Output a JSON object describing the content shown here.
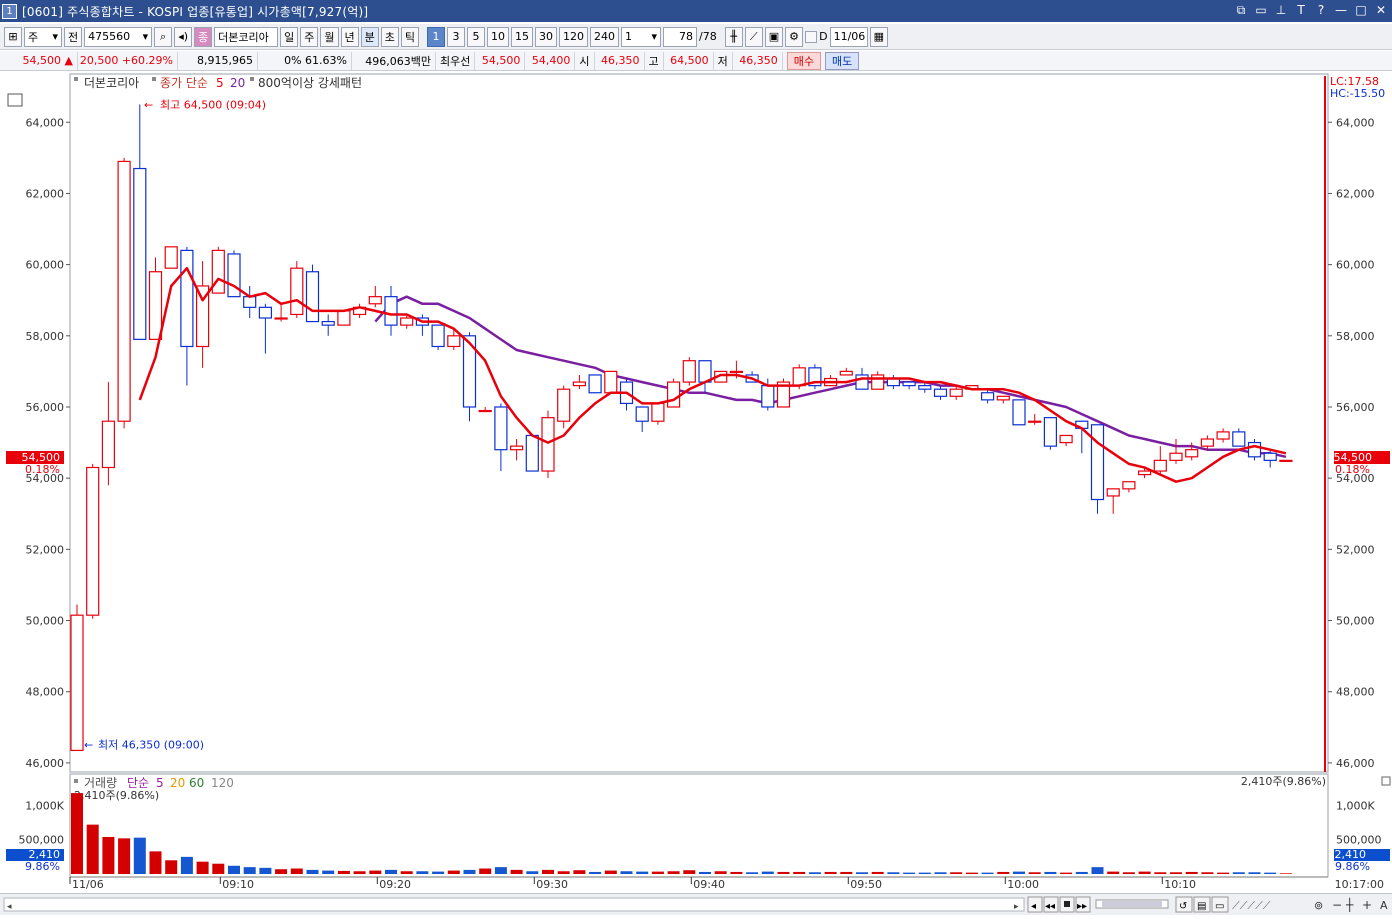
{
  "window": {
    "title": "[0601] 주식종합차트 - KOSPI 업종[유통업] 시가총액[7,927(억)]",
    "win_number": "1"
  },
  "toolbar": {
    "market_type": "주",
    "prev_label": "전",
    "code": "475560",
    "type_badge": "종",
    "stock_name": "더본코리아",
    "periods": [
      "일",
      "주",
      "월",
      "년",
      "분",
      "초",
      "틱"
    ],
    "intervals": [
      "1",
      "3",
      "5",
      "10",
      "15",
      "30",
      "120",
      "240"
    ],
    "count_value": "1",
    "page_current": "78",
    "page_total": "/78",
    "d_label": "D",
    "date": "11/06"
  },
  "pricebar": {
    "price": "54,500",
    "change": "20,500",
    "change_pct": "+60.29%",
    "volume": "8,915,965",
    "ratio1": "0%",
    "ratio2": "61.63%",
    "amount": "496,063백만",
    "priority_label": "최우선",
    "ask": "54,500",
    "bid": "54,400",
    "open_label": "시",
    "open": "46,350",
    "high_label": "고",
    "high": "64,500",
    "low_label": "저",
    "low": "46,350",
    "buy_label": "매수",
    "sell_label": "매도"
  },
  "chart_legend": {
    "name": "더본코리아",
    "ma_label": "종가 단순",
    "ma5": "5",
    "ma20": "20",
    "pattern": "800억이상 강세패턴",
    "lc": "LC:17.58",
    "hc": "HC:-15.50"
  },
  "annotations": {
    "high": "최고 64,500 (09:04)",
    "low": "최저 46,350 (09:00)",
    "last_price": "54,500",
    "last_pct": "0.18%"
  },
  "volume_legend": {
    "label": "거래량",
    "ma_label": "단순",
    "ma5": "5",
    "ma20": "20",
    "ma60": "60",
    "ma120": "120",
    "current": "2,410주(9.86%)",
    "last": "2,410",
    "last_pct": "9.86%"
  },
  "colors": {
    "up": "#e8000b",
    "down": "#0b2fd3",
    "ma5": "#e8000b",
    "ma20": "#7b1fa2",
    "accent_bar": "#d40000"
  },
  "chart_data": {
    "type": "candlestick",
    "x_ticks": [
      "11/06",
      "09:10",
      "09:20",
      "09:30",
      "09:40",
      "09:50",
      "10:00",
      "10:10"
    ],
    "time_end": "10:17:00",
    "ylim": [
      45800,
      65300
    ],
    "y_ticks": [
      "64,000",
      "62,000",
      "60,000",
      "58,000",
      "56,000",
      "54,000",
      "52,000",
      "50,000",
      "48,000",
      "46,000"
    ],
    "candles": [
      [
        46350,
        50450,
        46350,
        50150
      ],
      [
        50150,
        54400,
        50050,
        54300
      ],
      [
        54300,
        56700,
        53800,
        55600
      ],
      [
        55600,
        63000,
        55400,
        62900
      ],
      [
        62700,
        64500,
        62600,
        57900
      ],
      [
        57900,
        60200,
        57900,
        59800
      ],
      [
        59900,
        60500,
        59900,
        60500
      ],
      [
        60400,
        60500,
        56600,
        57700
      ],
      [
        57700,
        60100,
        57100,
        59400
      ],
      [
        59200,
        60500,
        59200,
        60400
      ],
      [
        60300,
        60400,
        59100,
        59100
      ],
      [
        59100,
        59400,
        58500,
        58800
      ],
      [
        58800,
        58900,
        57500,
        58500
      ],
      [
        58500,
        58900,
        58400,
        58500
      ],
      [
        58600,
        60100,
        58500,
        59900
      ],
      [
        59800,
        60000,
        58400,
        58400
      ],
      [
        58400,
        58600,
        58000,
        58300
      ],
      [
        58300,
        58700,
        58300,
        58700
      ],
      [
        58600,
        58900,
        58500,
        58800
      ],
      [
        58900,
        59400,
        58800,
        59100
      ],
      [
        59100,
        59400,
        58000,
        58300
      ],
      [
        58300,
        58600,
        58200,
        58500
      ],
      [
        58500,
        58600,
        58000,
        58300
      ],
      [
        58300,
        58300,
        57600,
        57700
      ],
      [
        57700,
        58200,
        57600,
        58000
      ],
      [
        58000,
        58100,
        55600,
        56000
      ],
      [
        55900,
        56000,
        55900,
        55900
      ],
      [
        56000,
        56100,
        54200,
        54800
      ],
      [
        54800,
        55100,
        54500,
        54900
      ],
      [
        55200,
        55200,
        54200,
        54200
      ],
      [
        54200,
        55900,
        54000,
        55700
      ],
      [
        55600,
        56600,
        55400,
        56500
      ],
      [
        56600,
        56900,
        56500,
        56700
      ],
      [
        56900,
        56900,
        56400,
        56400
      ],
      [
        56400,
        57000,
        56400,
        57000
      ],
      [
        56700,
        56800,
        55900,
        56100
      ],
      [
        56000,
        56000,
        55300,
        55600
      ],
      [
        55600,
        56100,
        55500,
        56100
      ],
      [
        56000,
        56800,
        56000,
        56700
      ],
      [
        56700,
        57400,
        56600,
        57300
      ],
      [
        57300,
        57300,
        56400,
        56700
      ],
      [
        56700,
        57000,
        56700,
        57000
      ],
      [
        57000,
        57300,
        56800,
        57000
      ],
      [
        56900,
        57000,
        56700,
        56700
      ],
      [
        56600,
        56800,
        55900,
        56000
      ],
      [
        56000,
        56800,
        56000,
        56700
      ],
      [
        56600,
        57200,
        56500,
        57100
      ],
      [
        57100,
        57200,
        56500,
        56600
      ],
      [
        56600,
        56900,
        56600,
        56800
      ],
      [
        56900,
        57100,
        56900,
        57000
      ],
      [
        56900,
        57100,
        56500,
        56500
      ],
      [
        56500,
        57000,
        56500,
        56900
      ],
      [
        56800,
        56900,
        56500,
        56600
      ],
      [
        56700,
        56700,
        56500,
        56600
      ],
      [
        56600,
        56700,
        56400,
        56500
      ],
      [
        56500,
        56600,
        56200,
        56300
      ],
      [
        56300,
        56600,
        56200,
        56500
      ],
      [
        56500,
        56600,
        56500,
        56600
      ],
      [
        56400,
        56500,
        56100,
        56200
      ],
      [
        56200,
        56300,
        56100,
        56300
      ],
      [
        56200,
        56200,
        55500,
        55500
      ],
      [
        55600,
        55800,
        55500,
        55600
      ],
      [
        55700,
        55700,
        54800,
        54900
      ],
      [
        55000,
        55200,
        54900,
        55200
      ],
      [
        55600,
        55600,
        54700,
        55400
      ],
      [
        55500,
        55500,
        53000,
        53400
      ],
      [
        53500,
        53700,
        53000,
        53700
      ],
      [
        53700,
        53900,
        53600,
        53900
      ],
      [
        54100,
        54300,
        54000,
        54200
      ],
      [
        54200,
        54900,
        54100,
        54500
      ],
      [
        54500,
        55100,
        54400,
        54700
      ],
      [
        54600,
        55000,
        54500,
        54800
      ],
      [
        54900,
        55200,
        54800,
        55100
      ],
      [
        55100,
        55400,
        55000,
        55300
      ],
      [
        55300,
        55400,
        54900,
        54900
      ],
      [
        55000,
        55100,
        54500,
        54600
      ],
      [
        54700,
        54800,
        54300,
        54500
      ],
      [
        54500,
        54500,
        54500,
        54500
      ]
    ],
    "ma5": [
      null,
      null,
      null,
      null,
      56200,
      57400,
      59400,
      59900,
      59000,
      59600,
      59400,
      59100,
      59200,
      58900,
      59000,
      58700,
      58700,
      58700,
      58800,
      58700,
      58600,
      58600,
      58400,
      58400,
      58200,
      57800,
      57300,
      56300,
      55700,
      55200,
      55000,
      55200,
      55700,
      56100,
      56400,
      56400,
      56100,
      56100,
      56200,
      56500,
      56700,
      56900,
      56900,
      56800,
      56600,
      56600,
      56600,
      56700,
      56700,
      56700,
      56800,
      56800,
      56800,
      56800,
      56700,
      56700,
      56600,
      56500,
      56500,
      56500,
      56400,
      56200,
      55900,
      55600,
      55400,
      55000,
      54700,
      54400,
      54300,
      54100,
      53900,
      54000,
      54300,
      54600,
      54800,
      54900,
      54800,
      54700
    ],
    "ma20": [
      null,
      null,
      null,
      null,
      null,
      null,
      null,
      null,
      null,
      null,
      null,
      null,
      null,
      null,
      null,
      null,
      null,
      null,
      null,
      58400,
      58900,
      59100,
      58900,
      58900,
      58700,
      58500,
      58200,
      57900,
      57600,
      57500,
      57400,
      57300,
      57200,
      57100,
      56900,
      56800,
      56700,
      56600,
      56500,
      56400,
      56400,
      56300,
      56200,
      56200,
      56100,
      56200,
      56300,
      56400,
      56500,
      56600,
      56700,
      56700,
      56700,
      56700,
      56700,
      56600,
      56600,
      56500,
      56500,
      56400,
      56300,
      56200,
      56100,
      56000,
      55800,
      55600,
      55400,
      55200,
      55100,
      55000,
      54900,
      54900,
      54800,
      54800,
      54800,
      54700,
      54700,
      54600
    ],
    "volume": {
      "ylim": [
        0,
        1400000
      ],
      "y_ticks": [
        "1,000K",
        "500,000"
      ],
      "values": [
        1180000,
        720000,
        540000,
        520000,
        530000,
        330000,
        200000,
        250000,
        180000,
        150000,
        120000,
        100000,
        90000,
        70000,
        80000,
        60000,
        50000,
        45000,
        40000,
        50000,
        60000,
        40000,
        40000,
        35000,
        50000,
        60000,
        80000,
        100000,
        60000,
        40000,
        60000,
        40000,
        55000,
        30000,
        50000,
        40000,
        35000,
        35000,
        40000,
        55000,
        30000,
        40000,
        30000,
        25000,
        35000,
        30000,
        30000,
        25000,
        30000,
        30000,
        25000,
        30000,
        25000,
        20000,
        20000,
        25000,
        25000,
        20000,
        20000,
        30000,
        35000,
        25000,
        30000,
        20000,
        30000,
        100000,
        35000,
        25000,
        35000,
        25000,
        25000,
        30000,
        25000,
        20000,
        25000,
        25000,
        20000,
        10000
      ]
    }
  }
}
